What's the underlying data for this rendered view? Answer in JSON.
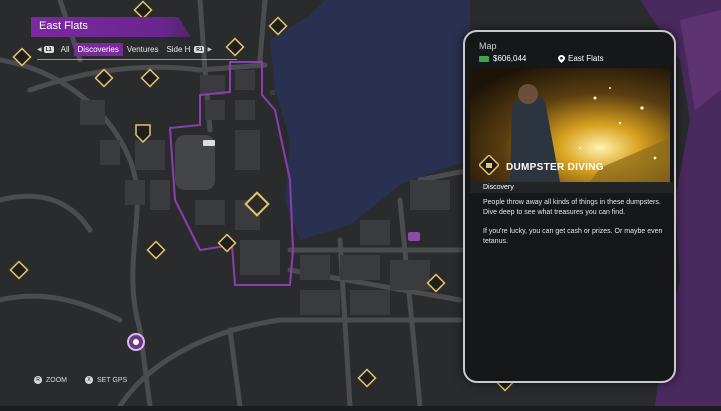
{
  "header": {
    "district": "East Flats"
  },
  "filters": {
    "left_button": "L1",
    "right_button": "R1",
    "tabs": [
      "All",
      "Discoveries",
      "Ventures",
      "Side H"
    ],
    "active_tab": "Discoveries"
  },
  "card": {
    "title": "Map",
    "money": "$606,044",
    "location": "East Flats",
    "discovery_title": "DUMPSTER DIVING",
    "category": "Discovery",
    "description_1": "People throw away all kinds of things in these dumpsters. Dive deep to see what treasures you can find.",
    "description_2": "If you're lucky, you can get cash or prizes. Or maybe even tetanus."
  },
  "controls": {
    "zoom_button": "R",
    "zoom_label": "ZOOM",
    "gps_button": "X",
    "gps_label": "SET GPS"
  },
  "colors": {
    "accent": "#7a2a9e",
    "water": "#2b3149",
    "land": "#2b2c2e",
    "road": "#4a4b4e",
    "marker": "#e6c468",
    "district_border": "#8a3fb0"
  },
  "map_markers": [
    {
      "icon": "discovery-icon"
    },
    {
      "icon": "shield-icon"
    },
    {
      "icon": "sports-icon"
    },
    {
      "icon": "location-pin-icon"
    },
    {
      "icon": "ventures-icon"
    }
  ]
}
